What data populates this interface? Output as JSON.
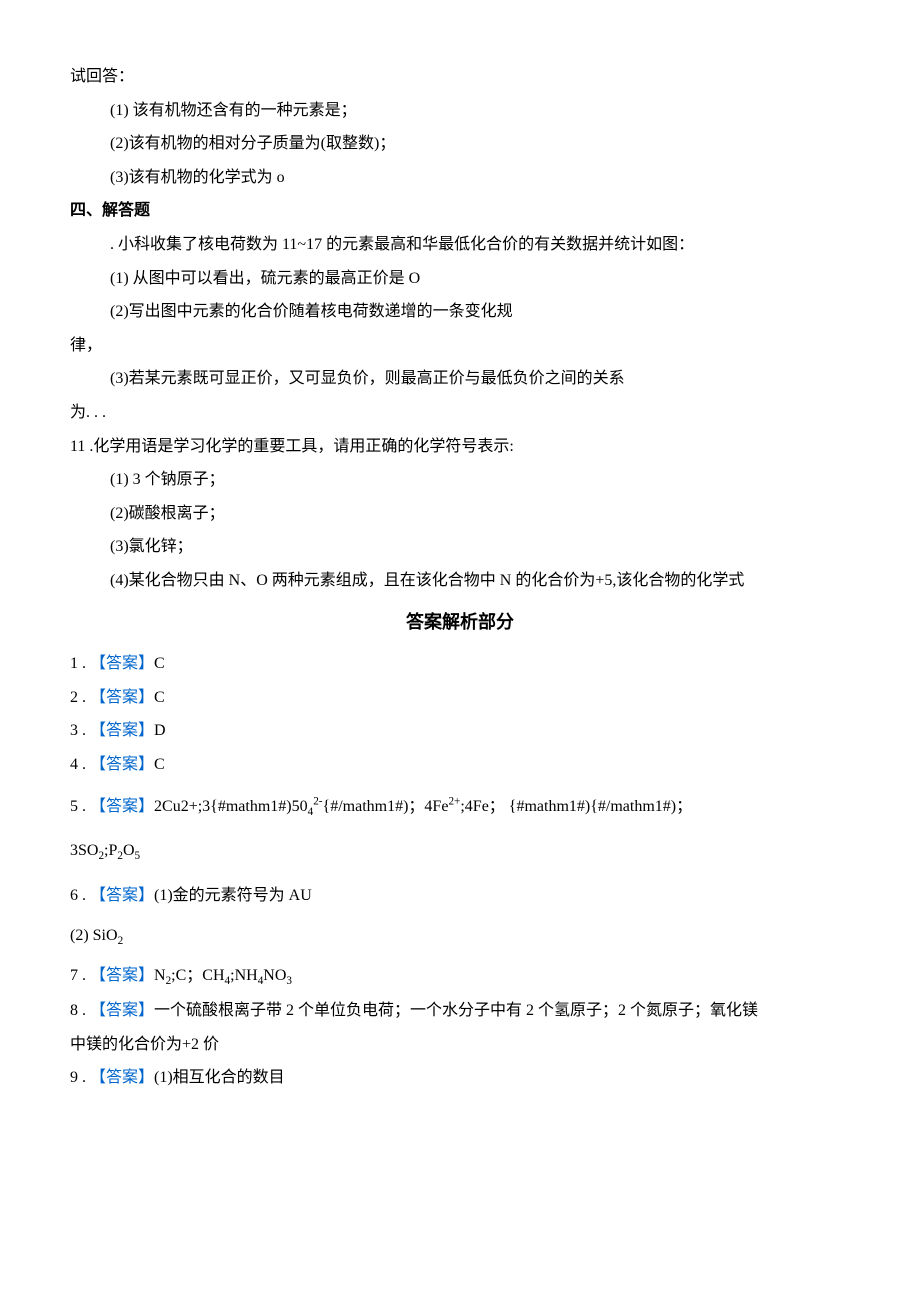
{
  "q_top": {
    "l0": "试回答：",
    "l1": "(1) 该有机物还含有的一种元素是；",
    "l2": "(2)该有机物的相对分子质量为(取整数)；",
    "l3": "(3)该有机物的化学式为 o"
  },
  "sec4": {
    "title": "四、解答题",
    "p1": ". 小科收集了核电荷数为 11~17 的元素最高和华最低化合价的有关数据并统计如图：",
    "p2": "(1) 从图中可以看出，硫元素的最高正价是 O",
    "p3": "(2)写出图中元素的化合价随着核电荷数递增的一条变化规",
    "p4": "律，",
    "p5": "(3)若某元素既可显正价，又可显负价，则最高正价与最低负价之间的关系",
    "p6": "为. . ."
  },
  "q11": {
    "intro": "11 .化学用语是学习化学的重要工具，请用正确的化学符号表示:",
    "l1": "(1)   3 个钠原子；",
    "l2": "(2)碳酸根离子；",
    "l3": "(3)氯化锌；",
    "l4": "(4)某化合物只由 N、O 两种元素组成，且在该化合物中 N 的化合价为+5,该化合物的化学式"
  },
  "ans_section_title": "答案解析部分",
  "ans": {
    "a1_pre": "1 .",
    "a1_tag": "【答案】",
    "a1_val": "C",
    "a2_pre": "2 .",
    "a2_tag": "【答案】",
    "a2_val": "C",
    "a3_pre": "3  .",
    "a3_tag": "【答案】",
    "a3_val": "D",
    "a4_pre": "4 .",
    "a4_tag": "【答案】",
    "a4_val": "C",
    "a5_pre": "5  .",
    "a5_tag": "【答案】",
    "a5_val_part1": "2Cu2+;3{#mathm1#)50",
    "a5_val_sub1": "4",
    "a5_val_sup1": "2-",
    "a5_val_part2": "{#/mathm1#)；4Fe",
    "a5_val_sup2": "2+",
    "a5_val_part3": ";4Fe； {#mathm1#){#/mathm1#)；",
    "a5_line2_p1": "3SO",
    "a5_line2_sub1": "2",
    "a5_line2_p2": ";P",
    "a5_line2_sub2": "2",
    "a5_line2_p3": "O",
    "a5_line2_sub3": "5",
    "a6_pre": "6 .",
    "a6_tag": "【答案】",
    "a6_val": "(1)金的元素符号为 AU",
    "a6_l2_p1": "(2)   SiO",
    "a6_l2_sub": "2",
    "a7_pre": "7  .",
    "a7_tag": "【答案】",
    "a7_p1": "N",
    "a7_sub1": "2",
    "a7_p2": ";C；CH",
    "a7_sub2": "4",
    "a7_p3": ";NH",
    "a7_sub3": "4",
    "a7_p4": "NO",
    "a7_sub4": "3",
    "a8_pre": "8 .",
    "a8_tag": "【答案】",
    "a8_val": "一个硫酸根离子带 2 个单位负电荷；一个水分子中有 2 个氢原子；2 个氮原子；氧化镁",
    "a8_val_l2": "中镁的化合价为+2 价",
    "a9_pre": "9 .",
    "a9_tag": "【答案】",
    "a9_val": "(1)相互化合的数目"
  }
}
